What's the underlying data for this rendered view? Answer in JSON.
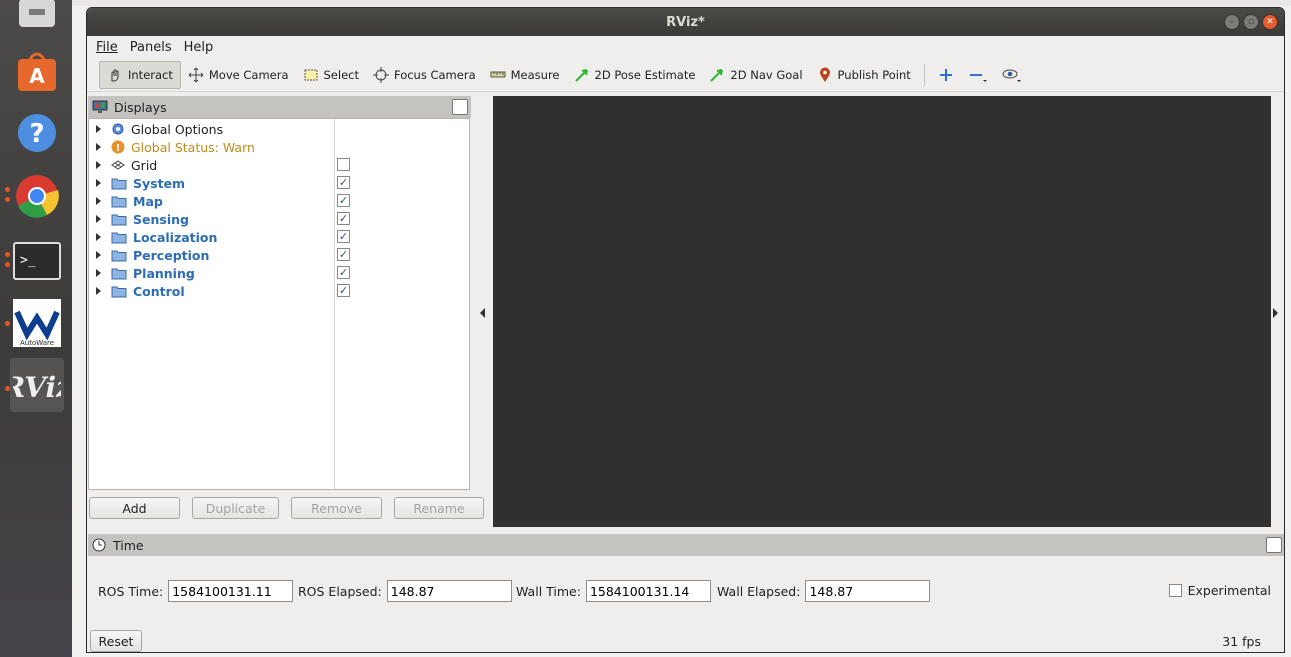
{
  "window": {
    "title": "RViz*"
  },
  "menu": {
    "file": "File",
    "panels": "Panels",
    "help": "Help"
  },
  "toolbar": {
    "interact": "Interact",
    "move_camera": "Move Camera",
    "select": "Select",
    "focus_camera": "Focus Camera",
    "measure": "Measure",
    "pose_estimate": "2D Pose Estimate",
    "nav_goal": "2D Nav Goal",
    "publish_point": "Publish Point"
  },
  "displays": {
    "title": "Displays",
    "items": [
      {
        "label": "Global Options",
        "type": "options"
      },
      {
        "label": "Global Status: Warn",
        "type": "warn"
      },
      {
        "label": "Grid",
        "type": "grid",
        "checked": false
      },
      {
        "label": "System",
        "type": "folder",
        "checked": true
      },
      {
        "label": "Map",
        "type": "folder",
        "checked": true
      },
      {
        "label": "Sensing",
        "type": "folder",
        "checked": true
      },
      {
        "label": "Localization",
        "type": "folder",
        "checked": true
      },
      {
        "label": "Perception",
        "type": "folder",
        "checked": true
      },
      {
        "label": "Planning",
        "type": "folder",
        "checked": true
      },
      {
        "label": "Control",
        "type": "folder",
        "checked": true
      }
    ],
    "buttons": {
      "add": "Add",
      "duplicate": "Duplicate",
      "remove": "Remove",
      "rename": "Rename"
    }
  },
  "time": {
    "title": "Time",
    "ros_time_label": "ROS Time:",
    "ros_time": "1584100131.11",
    "ros_elapsed_label": "ROS Elapsed:",
    "ros_elapsed": "148.87",
    "wall_time_label": "Wall Time:",
    "wall_time": "1584100131.14",
    "wall_elapsed_label": "Wall Elapsed:",
    "wall_elapsed": "148.87",
    "experimental": "Experimental",
    "reset": "Reset",
    "fps": "31 fps"
  },
  "dock": {
    "autoware_label": "AutoWare"
  },
  "colors": {
    "viewport": "#303030",
    "folder_label": "#2b6cb3",
    "warn_label": "#c08a1f",
    "close_button": "#e55b2b"
  }
}
